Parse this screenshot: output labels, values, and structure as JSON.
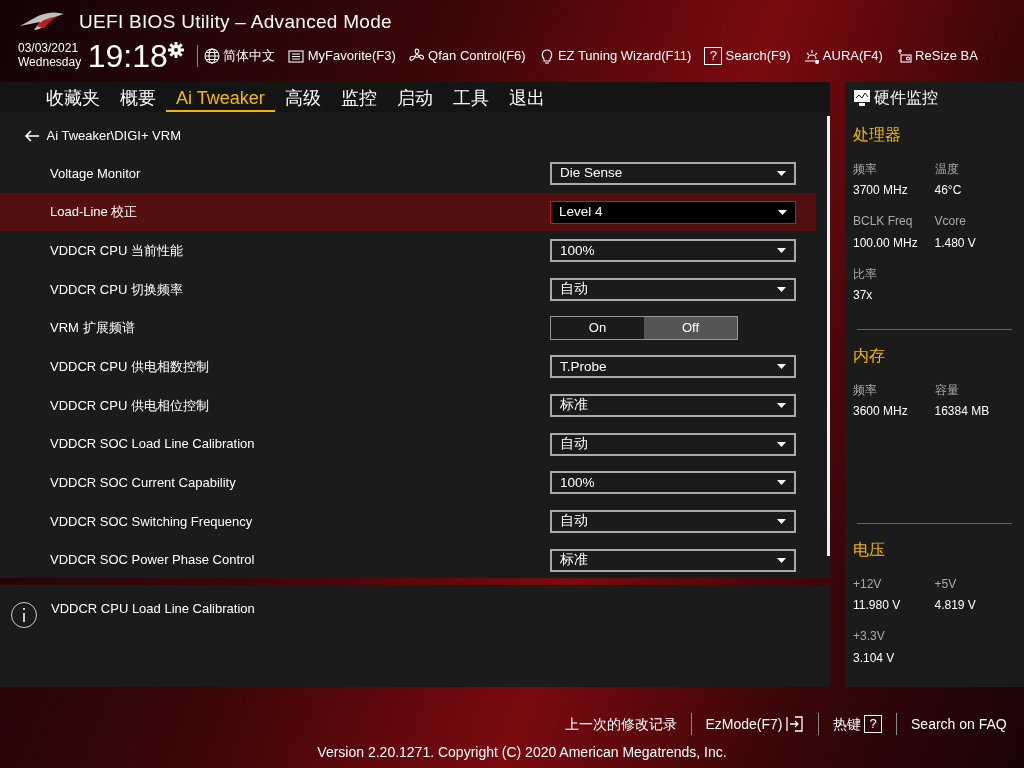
{
  "window": {
    "title": "UEFI BIOS Utility – Advanced Mode"
  },
  "clock": {
    "date": "03/03/2021",
    "weekday": "Wednesday",
    "time": "19:18"
  },
  "toolbar": [
    {
      "label": "简体中文"
    },
    {
      "label": "MyFavorite(F3)"
    },
    {
      "label": "Qfan Control(F6)"
    },
    {
      "label": "EZ Tuning Wizard(F11)"
    },
    {
      "label": "Search(F9)",
      "glyph": "?"
    },
    {
      "label": "AURA(F4)"
    },
    {
      "label": "ReSize BA"
    }
  ],
  "tabs": [
    {
      "label": "收藏夹",
      "selected": false
    },
    {
      "label": "概要",
      "selected": false
    },
    {
      "label": "Ai Tweaker",
      "selected": true
    },
    {
      "label": "高级",
      "selected": false
    },
    {
      "label": "监控",
      "selected": false
    },
    {
      "label": "启动",
      "selected": false
    },
    {
      "label": "工具",
      "selected": false
    },
    {
      "label": "退出",
      "selected": false
    }
  ],
  "breadcrumb": "Ai Tweaker\\DIGI+ VRM",
  "settings": [
    {
      "label": "Voltage Monitor",
      "kind": "select",
      "value": "Die Sense",
      "selected": false
    },
    {
      "label": "Load-Line 校正",
      "kind": "select",
      "value": "Level 4",
      "selected": true
    },
    {
      "label": "VDDCR CPU 当前性能",
      "kind": "select",
      "value": "100%",
      "selected": false
    },
    {
      "label": "VDDCR CPU 切换频率",
      "kind": "select",
      "value": "自动",
      "selected": false
    },
    {
      "label": "VRM 扩展频谱",
      "kind": "toggle",
      "selected": false,
      "options": [
        {
          "label": "On",
          "selected": false
        },
        {
          "label": "Off",
          "selected": true
        }
      ]
    },
    {
      "label": "VDDCR CPU 供电相数控制",
      "kind": "select",
      "value": "T.Probe",
      "selected": false
    },
    {
      "label": "VDDCR CPU 供电相位控制",
      "kind": "select",
      "value": "标准",
      "selected": false
    },
    {
      "label": "VDDCR SOC Load Line Calibration",
      "kind": "select",
      "value": "自动",
      "selected": false
    },
    {
      "label": "VDDCR SOC Current Capability",
      "kind": "select",
      "value": "100%",
      "selected": false
    },
    {
      "label": "VDDCR SOC Switching Frequency",
      "kind": "select",
      "value": "自动",
      "selected": false
    },
    {
      "label": "VDDCR SOC Power Phase Control",
      "kind": "select",
      "value": "标准",
      "selected": false
    }
  ],
  "help": "VDDCR CPU Load Line Calibration",
  "hardware_monitor": {
    "title": "硬件监控",
    "sections": [
      {
        "title": "处理器",
        "items": [
          {
            "label": "频率",
            "value": "3700 MHz"
          },
          {
            "label": "温度",
            "value": "46°C"
          },
          {
            "label": "BCLK Freq",
            "value": "100.00 MHz"
          },
          {
            "label": "Vcore",
            "value": "1.480 V"
          },
          {
            "label": "比率",
            "value": "37x"
          }
        ]
      },
      {
        "title": "内存",
        "items": [
          {
            "label": "频率",
            "value": "3600 MHz"
          },
          {
            "label": "容量",
            "value": "16384 MB"
          }
        ]
      },
      {
        "title": "电压",
        "items": [
          {
            "label": "+12V",
            "value": "11.980 V"
          },
          {
            "label": "+5V",
            "value": "4.819 V"
          },
          {
            "label": "+3.3V",
            "value": "3.104 V"
          }
        ]
      }
    ]
  },
  "footer_links": [
    {
      "label": "上一次的修改记录"
    },
    {
      "label": "EzMode(F7)"
    },
    {
      "label": "热键",
      "glyph": "?"
    },
    {
      "label": "Search on FAQ"
    }
  ],
  "version": "Version 2.20.1271. Copyright (C) 2020 American Megatrends, Inc."
}
